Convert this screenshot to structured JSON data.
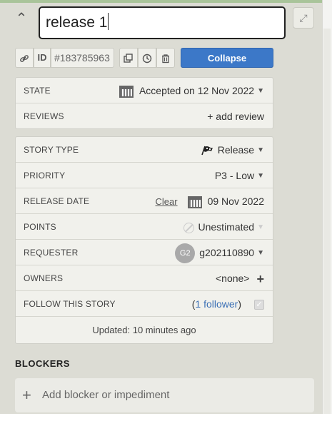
{
  "header": {
    "title_value": "release 1",
    "collapse_arrow": "⌃",
    "expand_icon": "⤢"
  },
  "toolbar": {
    "id_label": "ID",
    "id_value": "#183785963",
    "collapse_label": "Collapse"
  },
  "state_box": {
    "state_label": "STATE",
    "state_value": "Accepted on 12 Nov 2022",
    "reviews_label": "REVIEWS",
    "add_review": "+ add review"
  },
  "details": {
    "story_type_label": "STORY TYPE",
    "story_type_value": "Release",
    "priority_label": "PRIORITY",
    "priority_value": "P3 - Low",
    "release_date_label": "RELEASE DATE",
    "release_date_clear": "Clear",
    "release_date_value": "09 Nov 2022",
    "points_label": "POINTS",
    "points_value": "Unestimated",
    "requester_label": "REQUESTER",
    "requester_initials": "G2",
    "requester_value": "g202110890",
    "owners_label": "OWNERS",
    "owners_value": "<none>",
    "follow_label": "FOLLOW THIS STORY",
    "follow_prefix": "(",
    "follow_link": "1 follower",
    "follow_suffix": ")",
    "updated": "Updated: 10 minutes ago"
  },
  "blockers": {
    "heading": "BLOCKERS",
    "add_label": "Add blocker or impediment"
  },
  "colors": {
    "panel_bg": "#dcdcd4",
    "accent_blue": "#3c78c8",
    "link_blue": "#3a6fb5"
  },
  "icons": [
    "chevron-up-icon",
    "expand-icon",
    "link-icon",
    "copy-icon",
    "history-icon",
    "trash-icon",
    "calendar-icon",
    "flag-icon",
    "plus-icon",
    "checkbox-icon",
    "dropdown-arrow-icon"
  ]
}
